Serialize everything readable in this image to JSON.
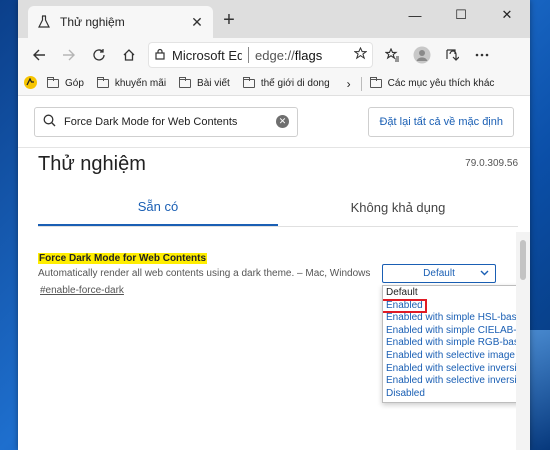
{
  "browser": {
    "tab_title": "Thử nghiệm",
    "tab_close": "✕",
    "new_tab": "+",
    "window_controls": {
      "minimize": "—",
      "maximize": "☐",
      "close": "✕"
    }
  },
  "toolbar": {
    "address_site": "Microsoft Ed",
    "address_scheme": "edge://",
    "address_path": "flags"
  },
  "favorites": {
    "items": [
      "Góp",
      "khuyến mãi",
      "Bài viết",
      "thế giới di dong"
    ],
    "other": "Các mục yêu thích khác"
  },
  "page": {
    "search_value": "Force Dark Mode for Web Contents",
    "reset_button": "Đặt lại tất cả về mặc định",
    "title": "Thử nghiệm",
    "version": "79.0.309.56",
    "tabs": {
      "available": "Sẵn có",
      "unavailable": "Không khả dụng"
    },
    "flag": {
      "name": "Force Dark Mode for Web Contents",
      "description": "Automatically render all web contents using a dark theme. – Mac, Windows",
      "link": "#enable-force-dark",
      "selected": "Default"
    },
    "options": [
      "Default",
      "Enabled",
      "Enabled with simple HSL-based inver",
      "Enabled with simple CIELAB-based in",
      "Enabled with simple RGB-based inver",
      "Enabled with selective image inversio",
      "Enabled with selective inversion of no",
      "Enabled with selective inversion of ev",
      "Disabled"
    ]
  },
  "colors": {
    "accent": "#1a5fb4",
    "highlight": "#ffee00",
    "callout": "#e01b24"
  },
  "icons": [
    "flask-icon",
    "back-icon",
    "forward-icon",
    "refresh-icon",
    "home-icon",
    "lock-icon",
    "star-icon",
    "favorites-icon",
    "profile-icon",
    "share-icon",
    "more-icon",
    "folder-icon",
    "search-icon",
    "clear-icon"
  ]
}
